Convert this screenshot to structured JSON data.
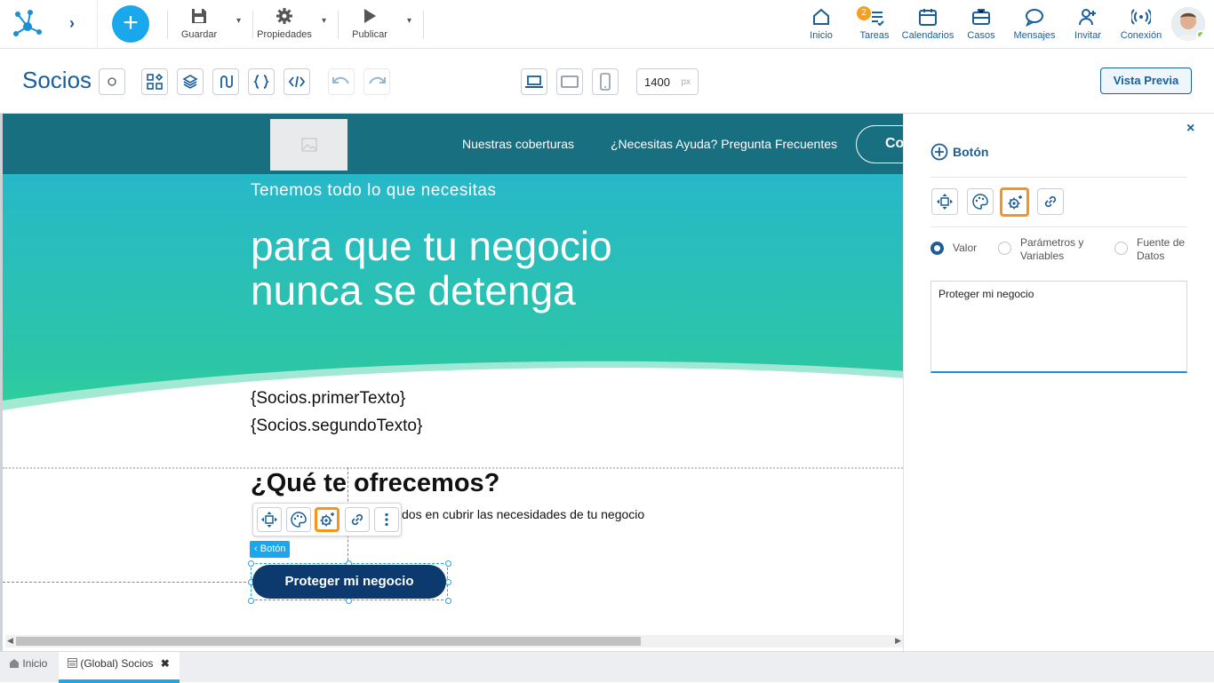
{
  "toolbar": {
    "save_label": "Guardar",
    "properties_label": "Propiedades",
    "publish_label": "Publicar"
  },
  "nav": {
    "home": "Inicio",
    "tasks": "Tareas",
    "tasks_badge": "2",
    "calendars": "Calendarios",
    "cases": "Casos",
    "messages": "Mensajes",
    "invite": "Invitar",
    "connection": "Conexión"
  },
  "editor": {
    "page_title": "Socios",
    "width_value": "1400",
    "width_unit": "px",
    "preview_label": "Vista Previa"
  },
  "site": {
    "nav_links": [
      "Nuestras coberturas",
      "¿Necesitas Ayuda? Pregunta Frecuentes"
    ],
    "cta_outline": "Co",
    "hero_sub": "Tenemos todo lo que necesitas",
    "hero_line1": "para que tu negocio",
    "hero_line2": "nunca se detenga",
    "var1": "{Socios.primerTexto}",
    "var2": "{Socios.segundoTexto}",
    "section_title": "¿Qué te ofrecemos?",
    "section_text": "dos en cubrir las necesidades de tu negocio",
    "selected_tag": "Botón",
    "button_label": "Proteger mi negocio"
  },
  "panel": {
    "title": "Botón",
    "radio_value": "Valor",
    "radio_params": "Parámetros y Variables",
    "radio_source": "Fuente de Datos",
    "value_text": "Proteger mi negocio"
  },
  "bottom": {
    "tab_home": "Inicio",
    "tab_socios": "(Global) Socios"
  },
  "colors": {
    "accent": "#1aa7ec",
    "brand": "#1a5e9a",
    "highlight": "#f7941d",
    "header": "#176f80",
    "cta": "#0c3a6e"
  }
}
